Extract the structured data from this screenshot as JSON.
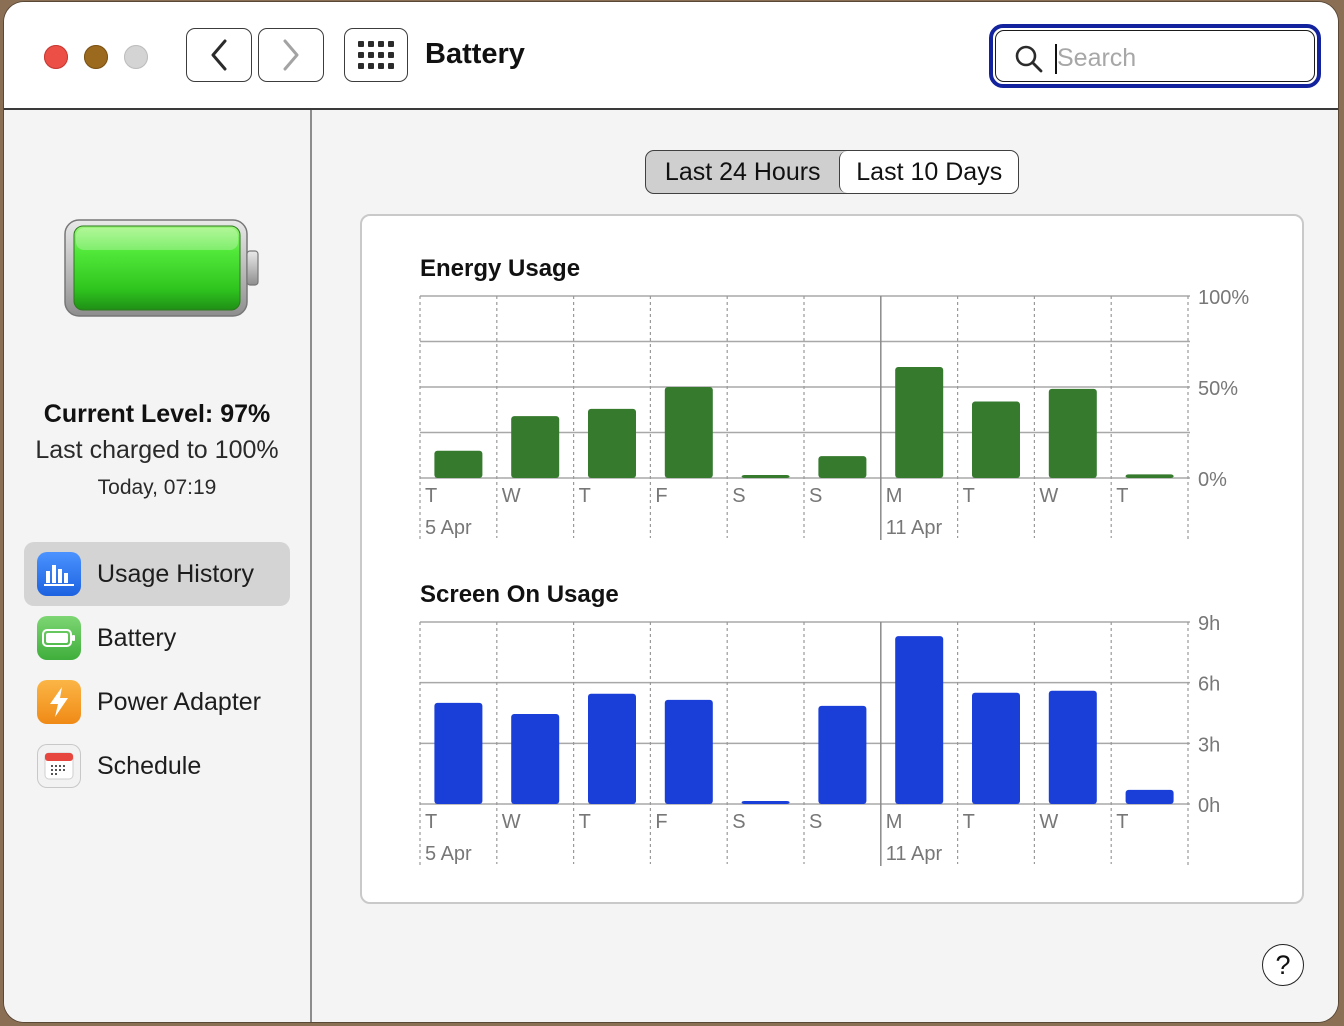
{
  "window": {
    "title": "Battery",
    "search_placeholder": "Search"
  },
  "sidebar": {
    "current_level": "Current Level: 97%",
    "last_charged": "Last charged to 100%",
    "last_charged_time": "Today, 07:19",
    "items": [
      {
        "label": "Usage History",
        "icon": "bar-chart-icon",
        "color": "#3478f6",
        "selected": true
      },
      {
        "label": "Battery",
        "icon": "battery-icon",
        "color": "#5ac05a",
        "selected": false
      },
      {
        "label": "Power Adapter",
        "icon": "lightning-bolt-icon",
        "color": "#f7a02a",
        "selected": false
      },
      {
        "label": "Schedule",
        "icon": "calendar-icon",
        "color": "#e6463e",
        "selected": false
      }
    ]
  },
  "segmented": {
    "options": [
      "Last 24 Hours",
      "Last 10 Days"
    ],
    "selected": "Last 10 Days"
  },
  "help": {
    "label": "?"
  },
  "chart_data": [
    {
      "type": "bar",
      "title": "Energy Usage",
      "categories": [
        "T",
        "W",
        "T",
        "F",
        "S",
        "S",
        "M",
        "T",
        "W",
        "T"
      ],
      "date_labels": [
        {
          "index": 0,
          "label": "5 Apr"
        },
        {
          "index": 6,
          "label": "11 Apr"
        }
      ],
      "values": [
        15,
        34,
        38,
        50,
        1,
        12,
        61,
        42,
        49,
        2
      ],
      "y_ticks": [
        "100%",
        "50%",
        "0%"
      ],
      "ylim": [
        0,
        100
      ],
      "unit": "%",
      "color": "#357a2d"
    },
    {
      "type": "bar",
      "title": "Screen On Usage",
      "categories": [
        "T",
        "W",
        "T",
        "F",
        "S",
        "S",
        "M",
        "T",
        "W",
        "T"
      ],
      "date_labels": [
        {
          "index": 0,
          "label": "5 Apr"
        },
        {
          "index": 6,
          "label": "11 Apr"
        }
      ],
      "values": [
        5.0,
        4.45,
        5.45,
        5.15,
        0.15,
        4.85,
        8.3,
        5.5,
        5.6,
        0.7
      ],
      "y_ticks": [
        "9h",
        "6h",
        "3h",
        "0h"
      ],
      "ylim": [
        0,
        9
      ],
      "unit": "h",
      "color": "#1a3ed8"
    }
  ]
}
